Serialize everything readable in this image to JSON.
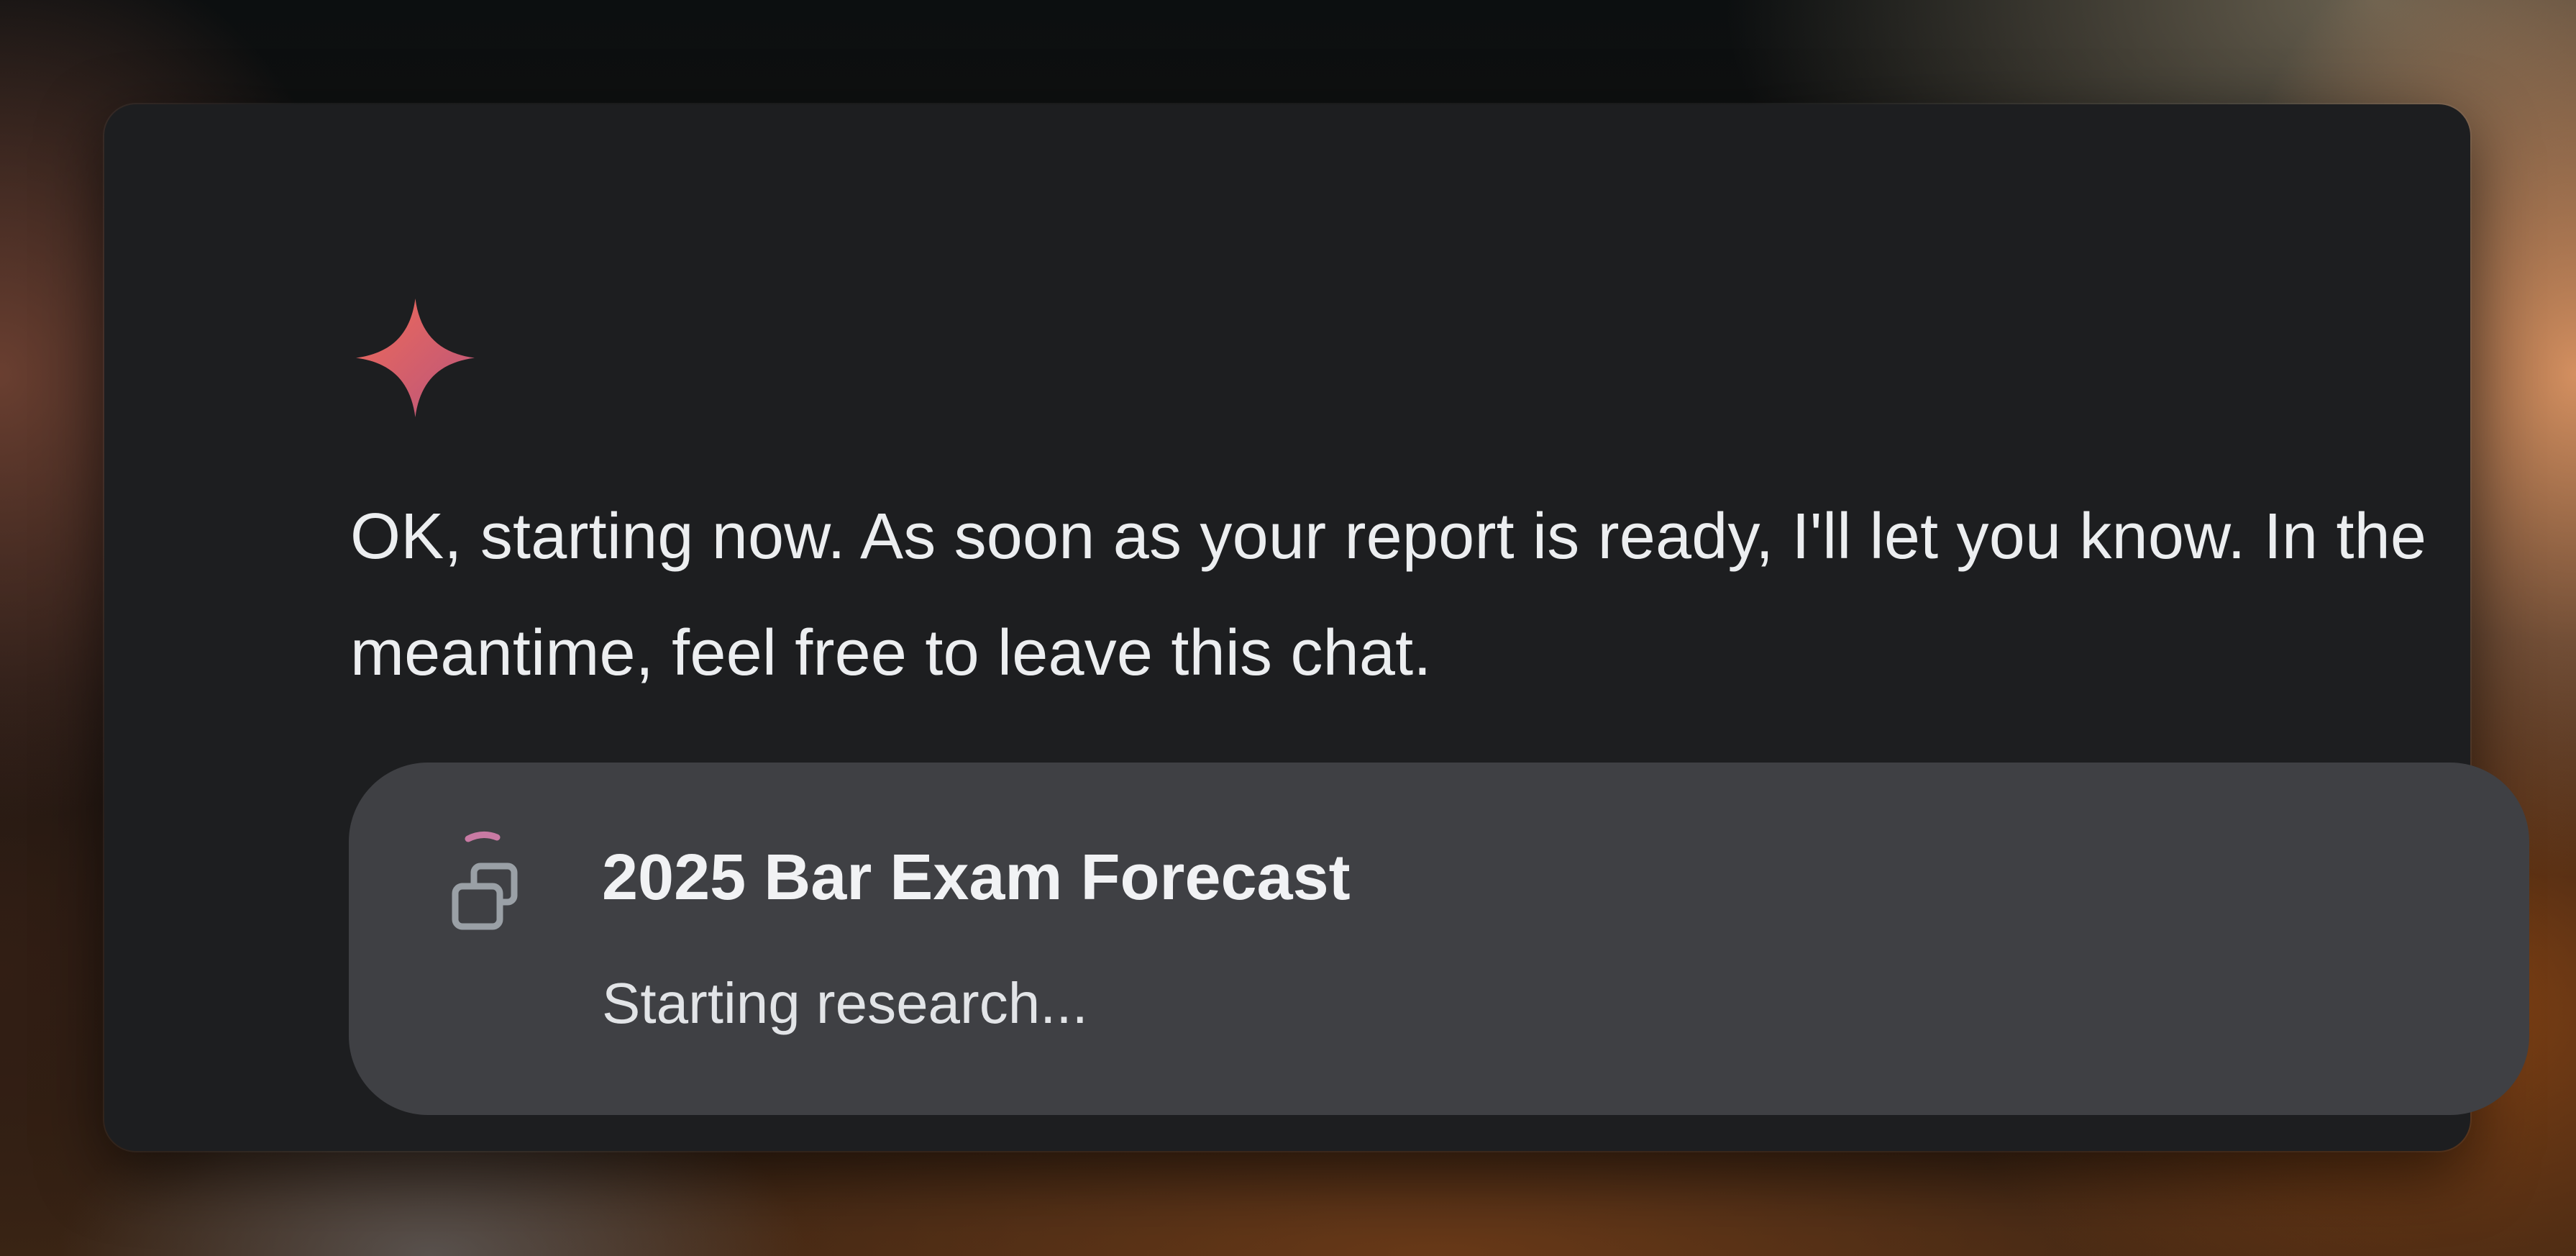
{
  "message": {
    "icon": "gemini-spark-icon",
    "text": "OK, starting now. As soon as your report is ready, I'll let you know. In the meantime, feel free to leave this chat."
  },
  "research_task": {
    "icon": "stacked-windows-spinner-icon",
    "title": "2025 Bar Exam Forecast",
    "status": "Starting research..."
  },
  "colors": {
    "card_background": "#1d1e20",
    "task_background": "#3f4044",
    "spark_gradient_start": "#f06a58",
    "spark_gradient_end": "#b9557d",
    "spinner_accent": "#c97aa4",
    "icon_gray": "#9aa0a6"
  }
}
